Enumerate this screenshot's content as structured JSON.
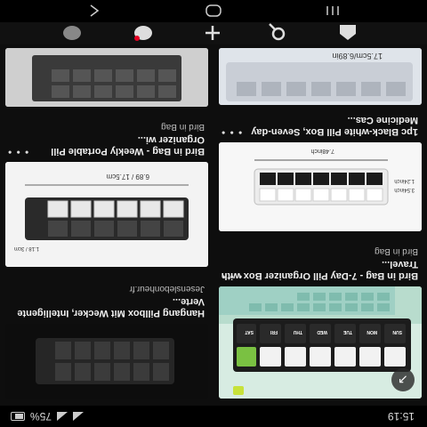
{
  "status": {
    "time": "15:19",
    "battery": "75%"
  },
  "cards": [
    {
      "title": "Bird in Bag - 7-Day Pill Organizer Box with Travel...",
      "source": "Bird in Bag",
      "days": [
        "SUN",
        "MON",
        "TUE",
        "WED",
        "THU",
        "FRI",
        "SAT"
      ]
    },
    {
      "title": "1pc Black-white Pill Box, Seven-day Medicine Cas...",
      "source": "",
      "dims": [
        "7.48inch",
        "3.54inch",
        "1.24inch"
      ],
      "dim_label_bottom": "17.5cm/6.89in"
    },
    {
      "title": "Hangang Pillbox Mit Wecker, Intelligente Verte...",
      "source": "Jesenslebonheur.fr"
    },
    {
      "title": "Bird in Bag - Weekly Portable Pill Organizer wi...",
      "source": "Bird in Bag",
      "dims": [
        "6.89 / 17.5cm",
        "1.18 / 3cm"
      ]
    },
    {
      "title": "",
      "source": ""
    }
  ],
  "tabs": [
    "home-icon",
    "search-icon",
    "create-icon",
    "notifications-icon",
    "profile-icon"
  ],
  "nav": [
    "recents-button",
    "home-button",
    "back-button"
  ],
  "colors": {
    "background": "#0e0e0e",
    "pill_dark": "#222222",
    "pill_light": "#e6e6e6",
    "photo_green": "#cfe8dc"
  }
}
